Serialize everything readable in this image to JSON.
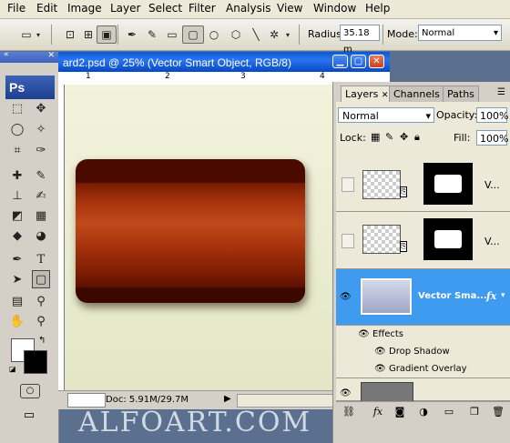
{
  "menubar": {
    "items": [
      "File",
      "Edit",
      "Image",
      "Layer",
      "Select",
      "Filter",
      "Analysis",
      "View",
      "Window",
      "Help"
    ]
  },
  "options": {
    "radius_label": "Radius:",
    "radius_value": "35.18 m",
    "mode_label": "Mode:",
    "mode_value": "Normal"
  },
  "toolbox": {
    "logo": "Ps"
  },
  "document": {
    "title": "ard2.psd @ 25% (Vector Smart Object, RGB/8)",
    "ruler_labels": [
      "1",
      "2",
      "3",
      "4"
    ],
    "status": "Doc: 5.91M/29.7M"
  },
  "layers_panel": {
    "tabs": [
      "Layers",
      "Channels",
      "Paths"
    ],
    "blend_mode": "Normal",
    "opacity_label": "Opacity:",
    "opacity_value": "100%",
    "lock_label": "Lock:",
    "fill_label": "Fill:",
    "fill_value": "100%",
    "layers": [
      {
        "name": "V...",
        "visible": false
      },
      {
        "name": "V...",
        "visible": false
      },
      {
        "name": "Vector Sma...",
        "visible": true,
        "selected": true,
        "fx": "fx"
      }
    ],
    "effects_label": "Effects",
    "effects": [
      "Drop Shadow",
      "Gradient Overlay"
    ]
  },
  "watermark": "ALFOART.COM",
  "colors": {
    "selection_blue": "#3f9bf0",
    "card_red": "#a8330c",
    "canvas_bg": "#eceed3"
  }
}
